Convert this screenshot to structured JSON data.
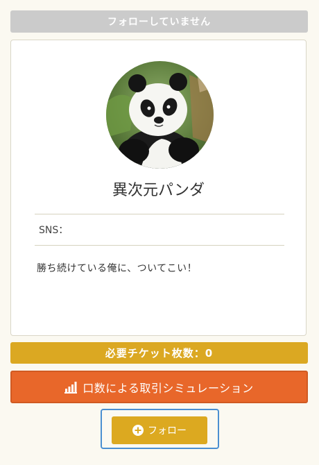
{
  "status": {
    "label": "フォローしていません"
  },
  "profile": {
    "name": "異次元パンダ",
    "sns_label": "SNS：",
    "bio": "勝ち続けている俺に、ついてこい！"
  },
  "ticket": {
    "label": "必要チケット枚数：0"
  },
  "simulation": {
    "label": "口数による取引シミュレーション",
    "icon": "bar-chart-icon"
  },
  "follow": {
    "label": "フォロー",
    "icon": "plus-circle-icon"
  },
  "colors": {
    "status_bg": "#cbcbcb",
    "ticket_bg": "#dba822",
    "simulation_bg": "#e8672a",
    "follow_bg": "#dca920",
    "focus_border": "#4a8fd1"
  }
}
